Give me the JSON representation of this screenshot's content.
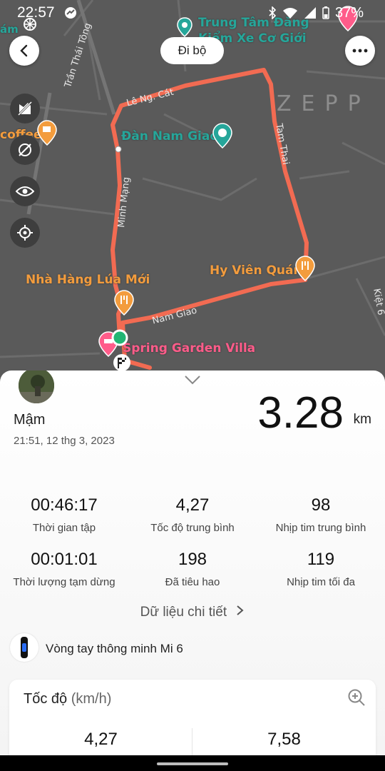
{
  "status_bar": {
    "time": "22:57",
    "battery": "37%"
  },
  "map": {
    "labels": {
      "trung_tam_1": "Trung Tâm Đăng",
      "trung_tam_2": "Kiểm Xe Cơ Giới",
      "tran_thai_tong": "Trần Thái Tông",
      "le_ng_cat": "Lê Ng. Cát",
      "coffee": "coffee",
      "dan_nam_giao": "Đàn Nam Giao",
      "tam_thai": "Tam Thai",
      "minh_mang": "Minh Mạng",
      "hy_vien_quan": "Hy Viên Quán",
      "nha_hang": "Nhà Hàng Lúa Mới",
      "nam_giao": "Nam Giao",
      "spring_garden": "Spring Garden Villa",
      "kiet": "Kiệt 6",
      "am": "ám",
      "brand": "ZEPP"
    }
  },
  "header": {
    "activity_type": "Đi bộ"
  },
  "workout": {
    "user": "Mậm",
    "datetime": "21:51, 12 thg 3, 2023",
    "distance": "3.28",
    "distance_unit": "km",
    "stats": [
      {
        "value": "00:46:17",
        "label": "Thời gian tập"
      },
      {
        "value": "4,27",
        "label": "Tốc độ trung bình"
      },
      {
        "value": "98",
        "label": "Nhịp tim trung bình"
      },
      {
        "value": "00:01:01",
        "label": "Thời lượng tạm dừng"
      },
      {
        "value": "198",
        "label": "Đã tiêu hao"
      },
      {
        "value": "119",
        "label": "Nhịp tim tối đa"
      }
    ],
    "detail_link": "Dữ liệu chi tiết",
    "device": "Vòng tay thông minh Mi 6"
  },
  "speed_card": {
    "title": "Tốc độ",
    "unit": "(km/h)",
    "value_left": "4,27",
    "value_right": "7,58"
  },
  "colors": {
    "route": "#f26b52",
    "map_bg": "#5a5a5a",
    "start_marker": "#22b573"
  }
}
